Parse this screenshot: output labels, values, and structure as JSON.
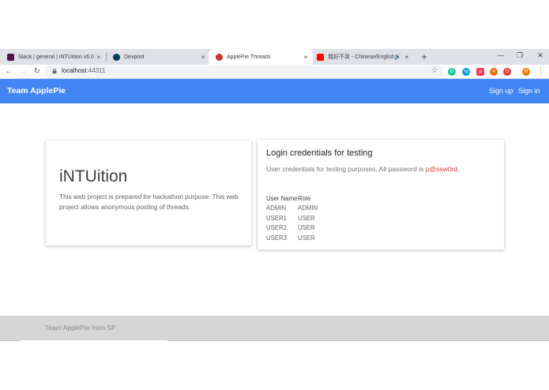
{
  "browser": {
    "tabs": [
      {
        "title": "Slack | general | iNTUition v6.0",
        "favicon": "slack-icon",
        "color": "#4a154b",
        "active": false
      },
      {
        "title": "Devpost",
        "favicon": "devpost-icon",
        "color": "#003e54",
        "active": false
      },
      {
        "title": "ApplePie Threads",
        "favicon": "applepie-icon",
        "color": "#c0392b",
        "active": true
      },
      {
        "title": "我好不哭 - Chinese/English",
        "favicon": "youtube-icon",
        "color": "#ff0000",
        "active": false,
        "audio": true
      }
    ],
    "close_glyph": "×",
    "new_tab_glyph": "+",
    "window_controls": {
      "minimize": "—",
      "maximize": "❐",
      "close": "✕"
    },
    "url_host": "localhost",
    "url_port": ":44311",
    "extensions": [
      {
        "name": "grammarly-icon",
        "color": "#15c39a",
        "glyph": "G"
      },
      {
        "name": "hp-icon",
        "color": "#0096d6",
        "glyph": "hp"
      },
      {
        "name": "pocket-icon",
        "color": "#ef4056",
        "glyph": "p"
      },
      {
        "name": "extension-orange-icon",
        "color": "#e8710a",
        "glyph": "✕"
      },
      {
        "name": "opera-icon",
        "color": "#e53935",
        "glyph": "O"
      },
      {
        "name": "profile-avatar",
        "color": "#f57c00",
        "glyph": "N"
      }
    ]
  },
  "navbar": {
    "brand": "Team ApplePie",
    "links": [
      "Sign up",
      "Sign in"
    ],
    "color": "#4285f4"
  },
  "intro_card": {
    "title": "iNTUition",
    "description": "This web project is prepared for hackathon purpose. This web project allows anonymous posting of threads."
  },
  "credentials_card": {
    "title": "Login credentials for testing",
    "subtitle_prefix": "User credentials for testing purposes. All password is ",
    "password": "p@ssw0rd",
    "subtitle_suffix": ".",
    "columns": [
      "User Name",
      "Role"
    ],
    "rows": [
      [
        "ADMIN",
        "ADMIN"
      ],
      [
        "USER1",
        "USER"
      ],
      [
        "USER2",
        "USER"
      ],
      [
        "USER3",
        "USER"
      ]
    ]
  },
  "footer": {
    "text": "Team ApplePie from SP"
  }
}
